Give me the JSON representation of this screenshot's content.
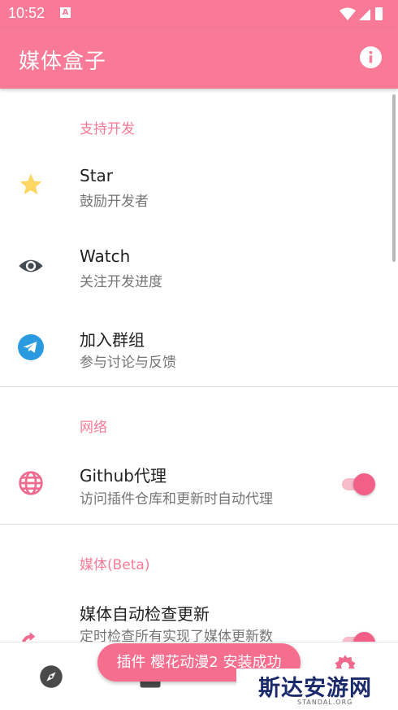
{
  "status_bar": {
    "time": "10:52",
    "notification": "A"
  },
  "app_bar": {
    "title": "媒体盒子",
    "info_icon": "info-icon"
  },
  "sections": {
    "support": {
      "title": "支持开发",
      "star": {
        "title": "Star",
        "subtitle": "鼓励开发者",
        "icon": "star-icon"
      },
      "watch": {
        "title": "Watch",
        "subtitle": "关注开发进度",
        "icon": "eye-icon"
      },
      "group": {
        "title": "加入群组",
        "subtitle": "参与讨论与反馈",
        "icon": "telegram-icon"
      }
    },
    "network": {
      "title": "网络",
      "proxy": {
        "title": "Github代理",
        "subtitle": "访问插件仓库和更新时自动代理",
        "enabled": true,
        "icon": "globe-icon"
      }
    },
    "media": {
      "title": "媒体(Beta)",
      "auto_update": {
        "title": "媒体自动检查更新",
        "subtitle": "定时检查所有实现了媒体更新数",
        "enabled": true,
        "icon": "refresh-icon"
      }
    }
  },
  "toast": {
    "text": "插件 樱花动漫2 安装成功"
  },
  "bottom_nav": {
    "items": [
      "compass-icon",
      "library-icon",
      "gear-icon"
    ]
  },
  "watermark": {
    "text": "斯达安游网",
    "sub": "STANDAL.ORG"
  },
  "colors": {
    "accent": "#f97a96",
    "toggle_thumb": "#f36087",
    "star": "#fdd663",
    "telegram": "#2a9ae0"
  }
}
